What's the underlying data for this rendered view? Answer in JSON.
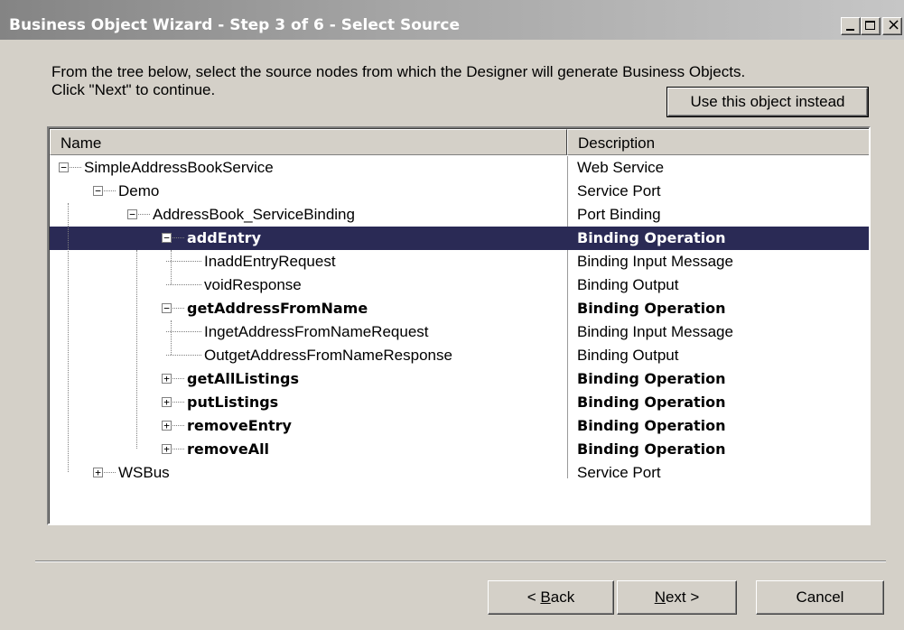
{
  "window": {
    "title": "Business Object Wizard - Step 3 of 6 - Select Source"
  },
  "instructions": "From the tree below, select the source nodes from which the Designer will generate Business Objects.\nClick \"Next\" to continue.",
  "use_object_button": "Use this object instead",
  "tree": {
    "columns": [
      "Name",
      "Description"
    ],
    "rows": [
      {
        "name": "SimpleAddressBookService",
        "description": "Web Service",
        "depth": 0,
        "expander": "minus",
        "bold": false,
        "selected": false
      },
      {
        "name": "Demo",
        "description": "Service Port",
        "depth": 1,
        "expander": "minus",
        "bold": false,
        "selected": false
      },
      {
        "name": "AddressBook_ServiceBinding",
        "description": "Port Binding",
        "depth": 2,
        "expander": "minus",
        "bold": false,
        "selected": false
      },
      {
        "name": "addEntry",
        "description": "Binding Operation",
        "depth": 3,
        "expander": "minus",
        "bold": true,
        "selected": true
      },
      {
        "name": "InaddEntryRequest",
        "description": "Binding Input Message",
        "depth": 4,
        "expander": "none",
        "bold": false,
        "selected": false
      },
      {
        "name": "voidResponse",
        "description": "Binding Output",
        "depth": 4,
        "expander": "none",
        "bold": false,
        "selected": false
      },
      {
        "name": "getAddressFromName",
        "description": "Binding Operation",
        "depth": 3,
        "expander": "minus",
        "bold": true,
        "selected": false
      },
      {
        "name": "IngetAddressFromNameRequest",
        "description": "Binding Input Message",
        "depth": 4,
        "expander": "none",
        "bold": false,
        "selected": false
      },
      {
        "name": "OutgetAddressFromNameResponse",
        "description": "Binding Output",
        "depth": 4,
        "expander": "none",
        "bold": false,
        "selected": false
      },
      {
        "name": "getAllListings",
        "description": "Binding Operation",
        "depth": 3,
        "expander": "plus",
        "bold": true,
        "selected": false
      },
      {
        "name": "putListings",
        "description": "Binding Operation",
        "depth": 3,
        "expander": "plus",
        "bold": true,
        "selected": false
      },
      {
        "name": "removeEntry",
        "description": "Binding Operation",
        "depth": 3,
        "expander": "plus",
        "bold": true,
        "selected": false
      },
      {
        "name": "removeAll",
        "description": "Binding Operation",
        "depth": 3,
        "expander": "plus",
        "bold": true,
        "selected": false
      },
      {
        "name": "WSBus",
        "description": "Service Port",
        "depth": 1,
        "expander": "plus",
        "bold": false,
        "selected": false
      }
    ]
  },
  "buttons": {
    "back": {
      "prefix": "< ",
      "accel": "B",
      "rest": "ack"
    },
    "next": {
      "accel": "N",
      "rest": "ext >"
    },
    "cancel": "Cancel"
  },
  "colors": {
    "selection": "#2a2a55",
    "dialog_bg": "#d4d0c8"
  }
}
